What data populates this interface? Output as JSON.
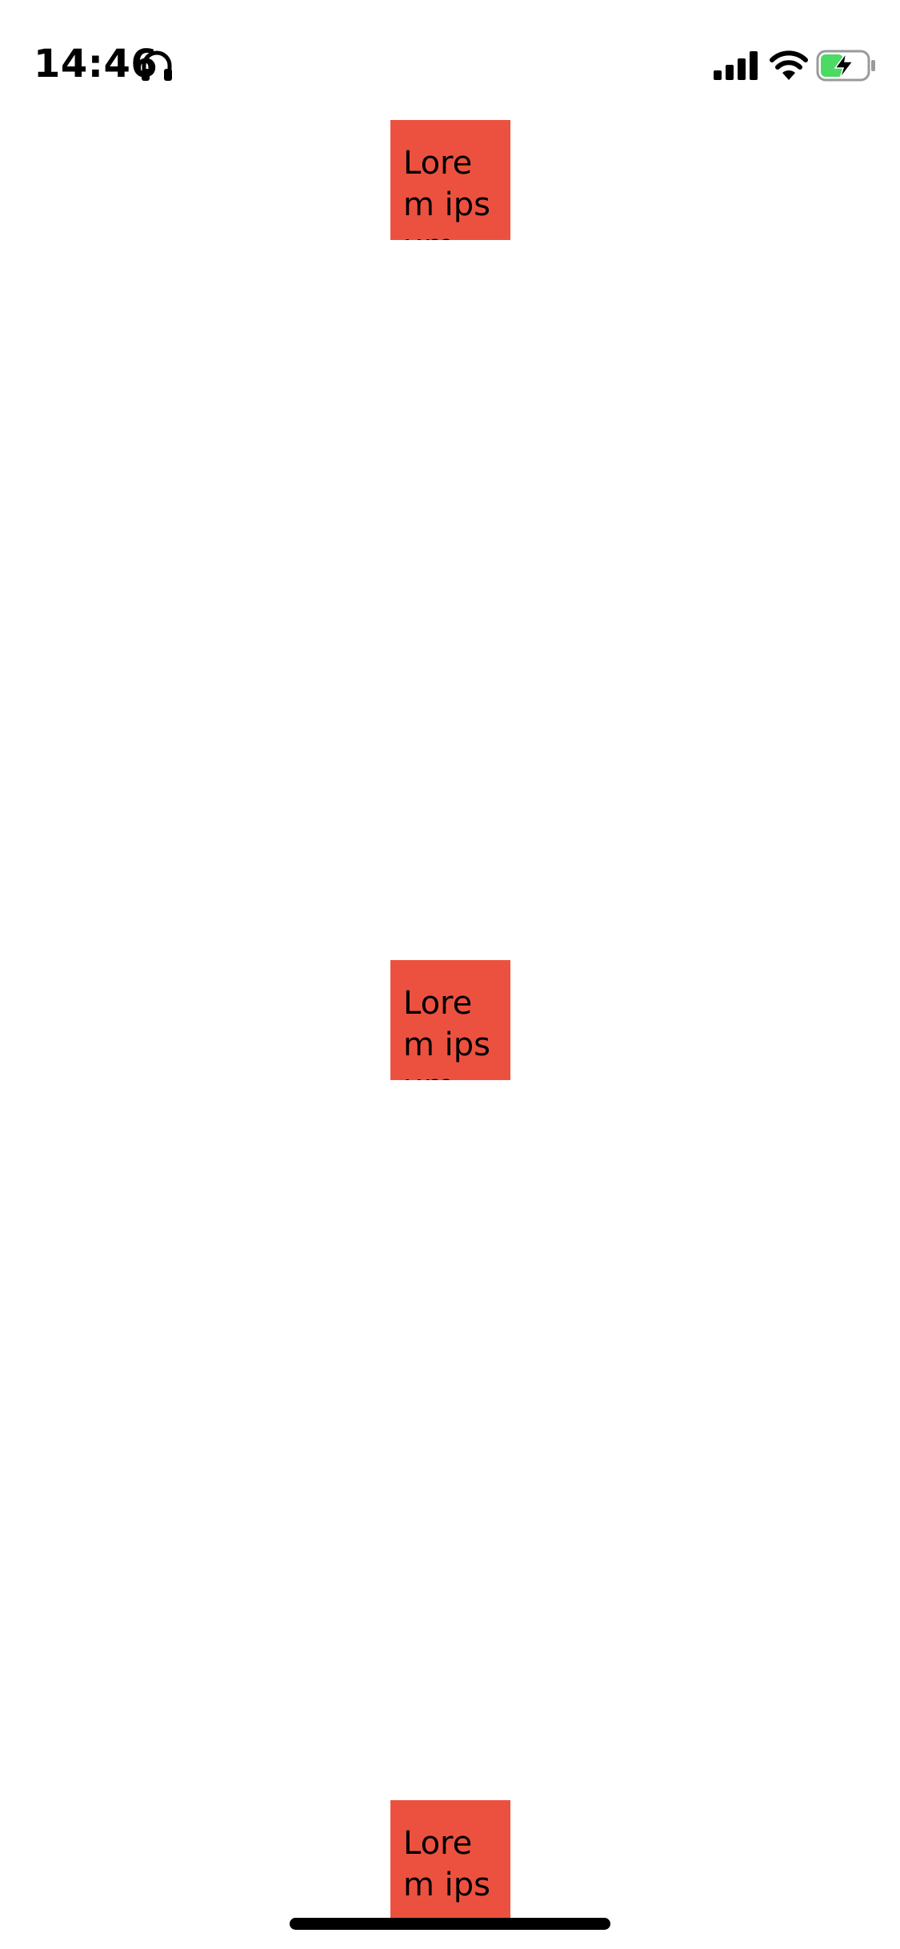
{
  "status_bar": {
    "time": "14:46",
    "icons": [
      "headphones-icon",
      "signal-icon",
      "wifi-icon",
      "battery-charging-icon"
    ],
    "battery_color": "#4cd964"
  },
  "boxes": [
    {
      "text": "Lorem ipsum"
    },
    {
      "text": "Lorem ipsum"
    },
    {
      "text": "Lorem ipsum"
    }
  ],
  "colors": {
    "box_background": "#ec5140",
    "background": "#ffffff"
  }
}
